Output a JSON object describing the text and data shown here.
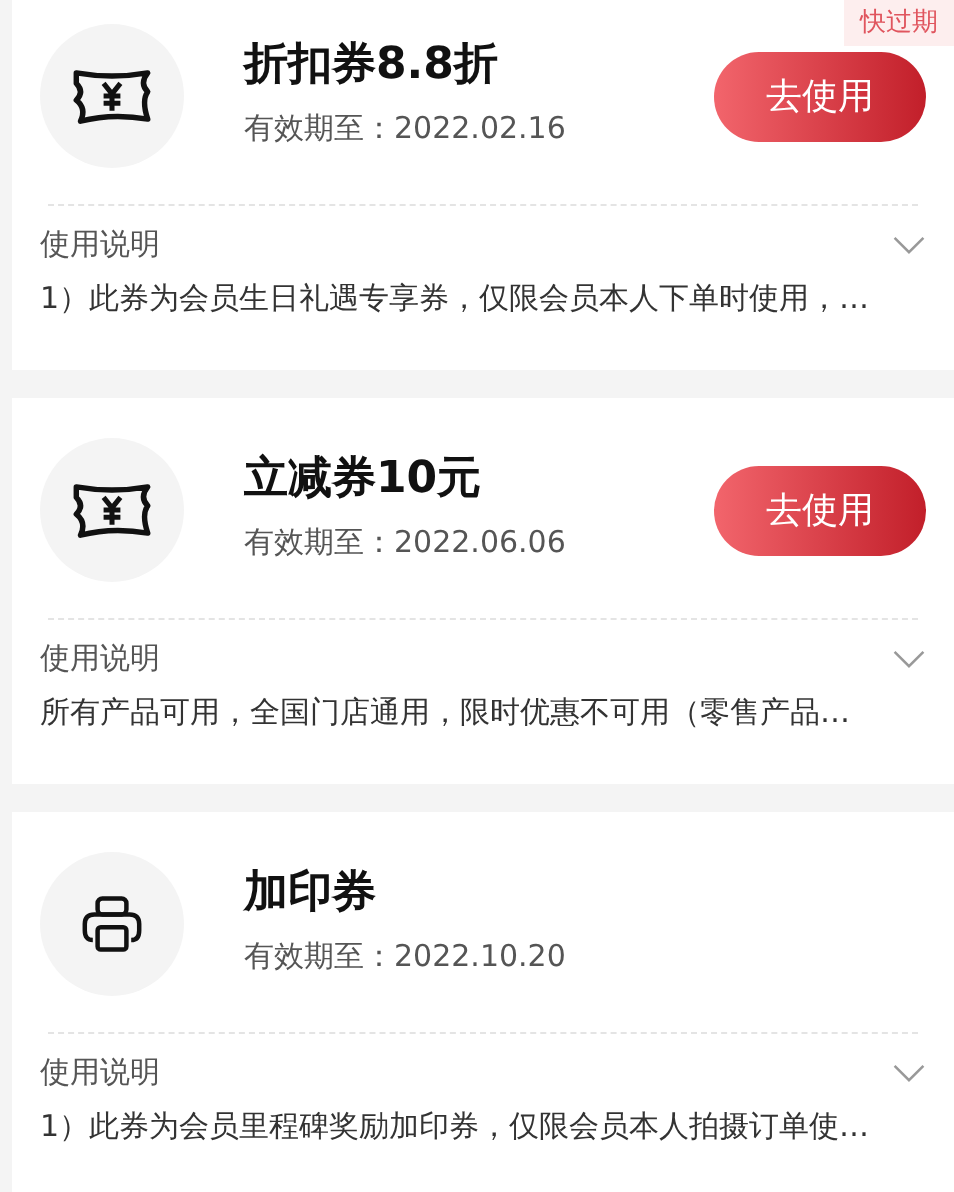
{
  "coupons": [
    {
      "kind": "ticket",
      "title": "折扣券8.8折",
      "validity": "有效期至：2022.02.16",
      "badge": "快过期",
      "button": "去使用",
      "instructions_label": "使用说明",
      "expanded": false,
      "description": "1）此券为会员生日礼遇专享券，仅限会员本人下单时使用，…"
    },
    {
      "kind": "ticket",
      "title": "立减券10元",
      "validity": "有效期至：2022.06.06",
      "button": "去使用",
      "instructions_label": "使用说明",
      "expanded": false,
      "description": "所有产品可用，全国门店通用，限时优惠不可用（零售产品…"
    },
    {
      "kind": "printer",
      "title": "加印券",
      "validity": "有效期至：2022.10.20",
      "instructions_label": "使用说明",
      "expanded": false,
      "description": "1）此券为会员里程碑奖励加印券，仅限会员本人拍摄订单使…"
    }
  ]
}
